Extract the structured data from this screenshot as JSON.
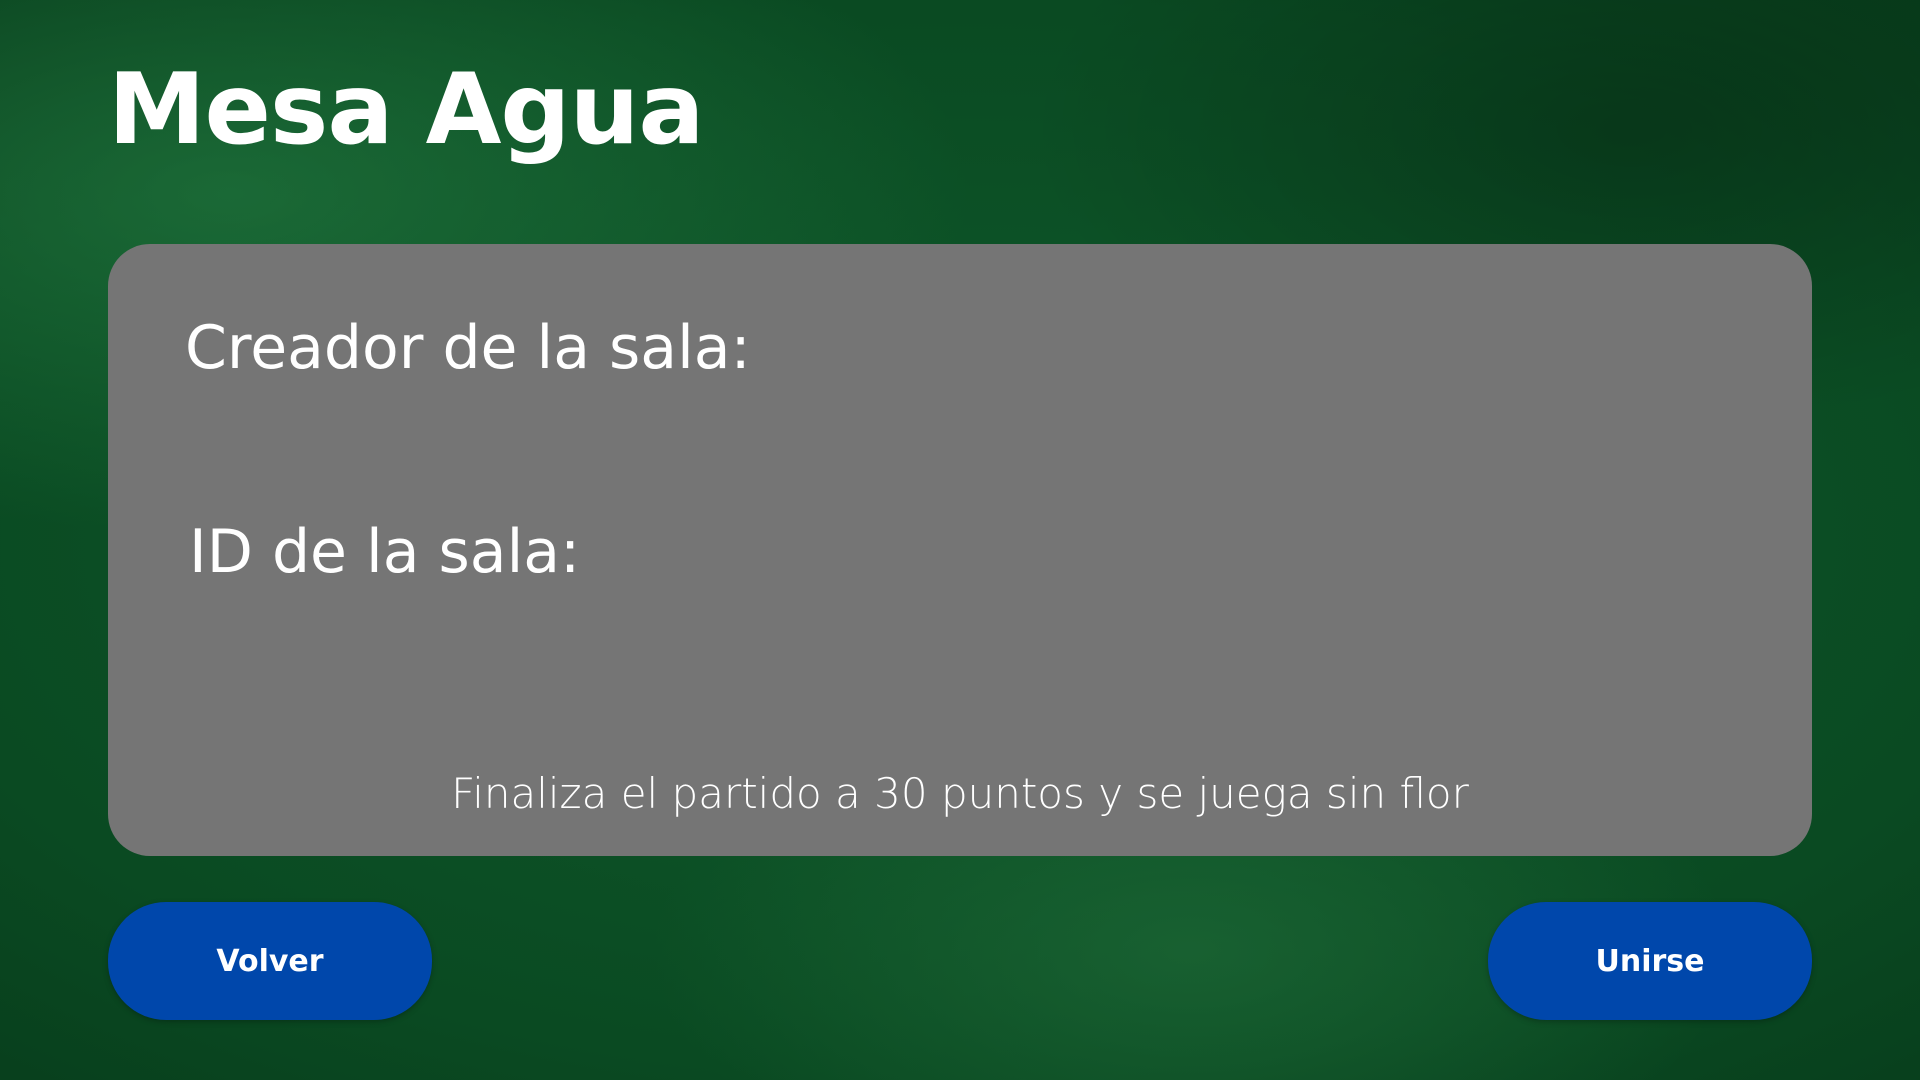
{
  "page": {
    "title": "Mesa Agua"
  },
  "room_info": {
    "creator_label": "Creador de la sala:",
    "room_id_label": "ID de la sala:",
    "rules_text": "Finaliza el partido a 30 puntos y se juega sin flor"
  },
  "actions": {
    "back_label": "Volver",
    "join_label": "Unirse"
  },
  "colors": {
    "background": "#0b4d24",
    "panel": "#757575",
    "button": "#0047ab",
    "text": "#ffffff"
  }
}
